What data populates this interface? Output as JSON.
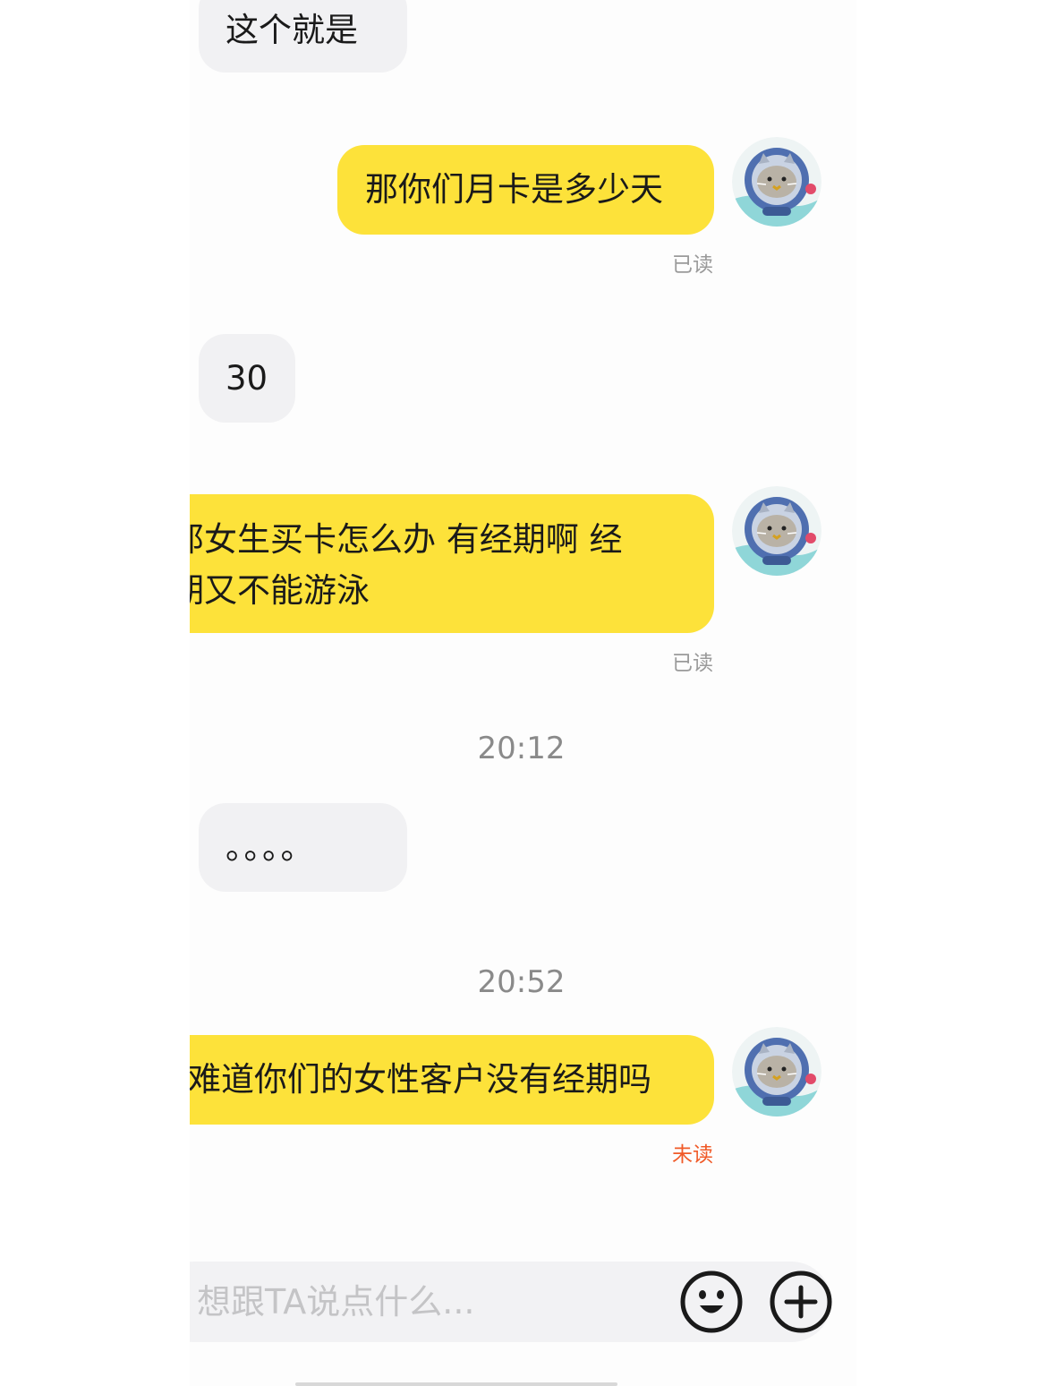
{
  "messages": [
    {
      "side": "incoming",
      "text": "这个就是"
    },
    {
      "side": "outgoing",
      "text": "那你们月卡是多少天",
      "status": "已读"
    },
    {
      "side": "incoming",
      "text": "30"
    },
    {
      "side": "outgoing",
      "line1": "那女生买卡怎么办 有经期啊 经",
      "line2": "期又不能游泳",
      "status": "已读"
    },
    {
      "side": "incoming",
      "text": "。。。。"
    },
    {
      "side": "outgoing",
      "text": "难道你们的女性客户没有经期吗",
      "status": "未读"
    }
  ],
  "timestamps": [
    "20:12",
    "20:52"
  ],
  "input": {
    "placeholder": "想跟TA说点什么..."
  },
  "icons": {
    "avatar": "cat-astronaut-avatar-icon",
    "emoji": "smiley-face-icon",
    "plus": "plus-circle-icon"
  },
  "colors": {
    "outgoing_bubble": "#fde23a",
    "incoming_bubble": "#f1f1f3",
    "unread": "#f05a28",
    "read": "#9a9a9a"
  }
}
